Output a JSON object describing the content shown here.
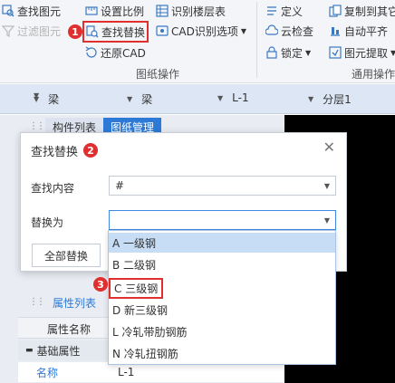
{
  "ribbon": {
    "col1": [
      "查找图元",
      "过滤图元"
    ],
    "col2": [
      "设置比例",
      "查找替换",
      "还原CAD"
    ],
    "col3": [
      "识别楼层表",
      "CAD识别选项"
    ],
    "col4": [
      "定义",
      "云检查",
      "锁定"
    ],
    "col5": [
      "复制到其它",
      "自动平齐",
      "图元提取"
    ],
    "group_label_drawing": "图纸操作",
    "group_label_general": "通用操作"
  },
  "annotations": {
    "step1": "1",
    "step2": "2",
    "step3": "3"
  },
  "filterbar": {
    "cell1": "",
    "cell2": "梁",
    "cell3": "梁",
    "cell4": "L-1",
    "cell5": "分层1"
  },
  "panel": {
    "tab1": "构件列表",
    "tab2": "图纸管理"
  },
  "dialog": {
    "title": "查找替换",
    "find_label": "查找内容",
    "find_value": "#",
    "replace_label": "替换为",
    "replace_value": "",
    "replace_all_button": "全部替换"
  },
  "dropdown": {
    "options": [
      "A 一级钢",
      "B 二级钢",
      "C 三级钢",
      "D 新三级钢",
      "L 冷轧带肋钢筋",
      "N 冷轧扭钢筋"
    ],
    "hovered_index": 0,
    "highlighted_index": 2
  },
  "properties": {
    "tab": "属性列表",
    "header_name": "属性名称",
    "section": "基础属性",
    "row_name_label": "名称",
    "row_name_value": "L-1"
  },
  "colors": {
    "accent": "#2d7ad6",
    "annotation_red": "#e02f2f",
    "hover": "#c7ddf5"
  }
}
